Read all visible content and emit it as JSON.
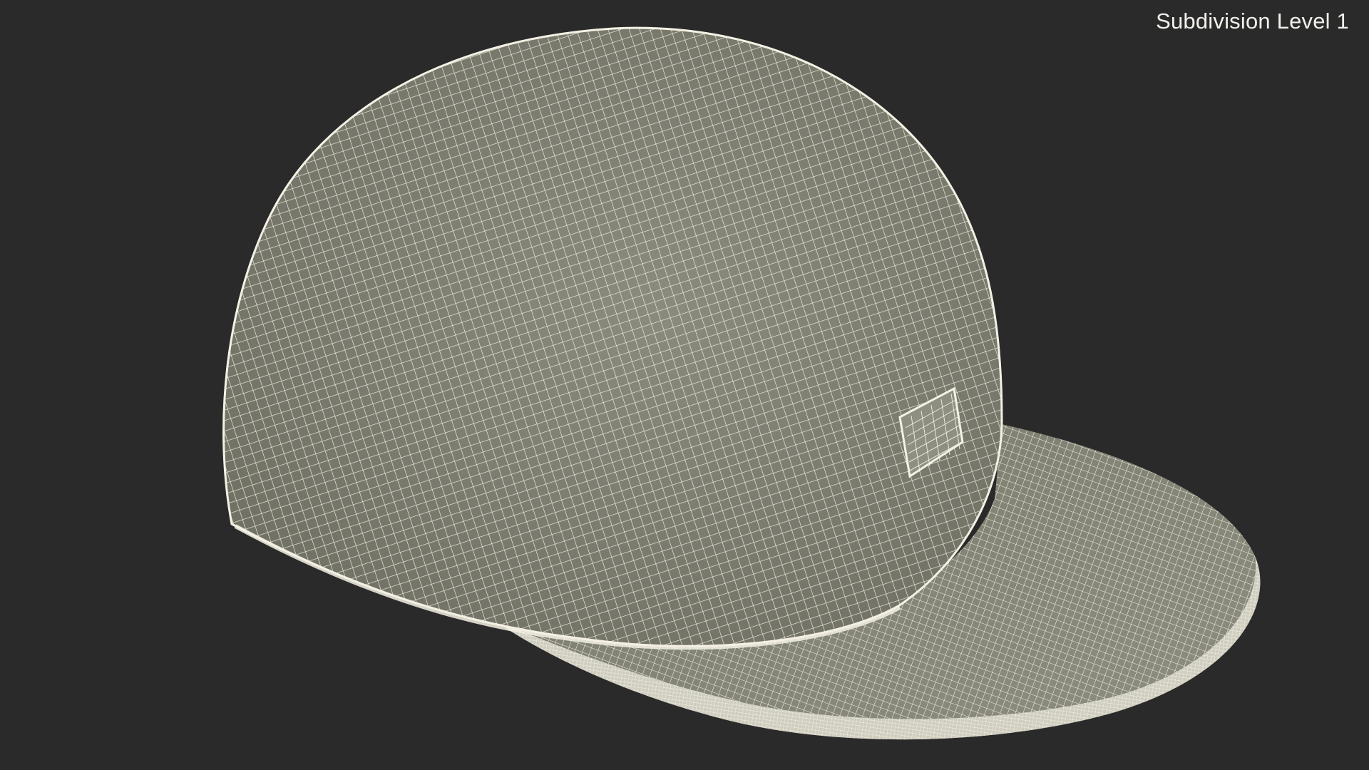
{
  "overlay": {
    "label": "Subdivision Level 1"
  },
  "render": {
    "subject": "cap-icon",
    "background_color": "#2a2a2a",
    "shell_color": "#7c7d6f",
    "wire_color": "#f3f1e4"
  }
}
